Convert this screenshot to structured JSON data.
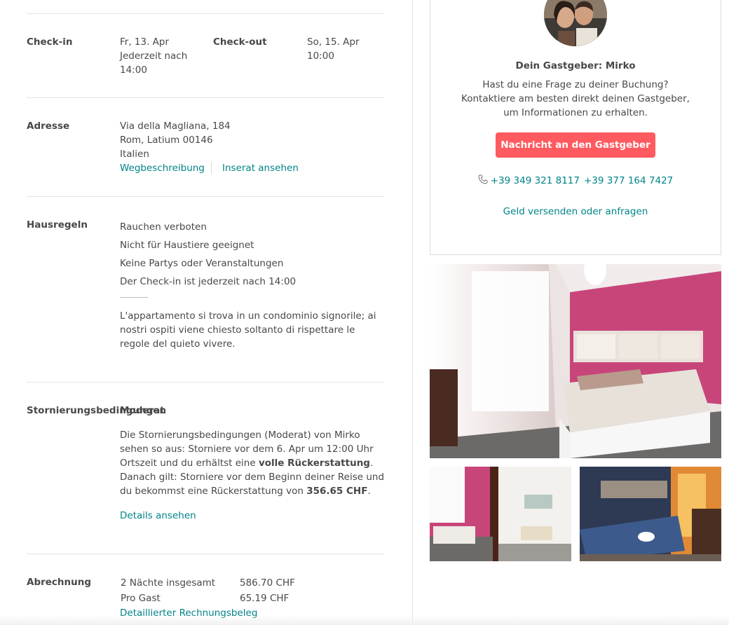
{
  "checkin": {
    "label": "Check-in",
    "date": "Fr, 13. Apr",
    "time": "Jederzeit nach 14:00",
    "checkout_label": "Check-out",
    "checkout_date": "So, 15. Apr",
    "checkout_time": "10:00"
  },
  "address": {
    "label": "Adresse",
    "line1": "Via della Magliana, 184",
    "line2": "Rom, Latium 00146",
    "line3": "Italien",
    "directions_link": "Wegbeschreibung",
    "listing_link": "Inserat ansehen"
  },
  "house_rules": {
    "label": "Hausregeln",
    "rules": [
      "Rauchen verboten",
      "Nicht für Haustiere geeignet",
      "Keine Partys oder Veranstaltungen",
      "Der Check-in ist jederzeit nach 14:00"
    ],
    "note": "L'appartamento si trova in un condominio signorile; ai nostri ospiti viene chiesto soltanto di rispettare le regole del quieto vivere."
  },
  "cancellation": {
    "label": "Stornierungsbedingungen",
    "policy": "Moderat",
    "text_1": "Die Stornierungsbedingungen (Moderat) von Mirko sehen so aus: Storniere vor dem 6. Apr um 12:00 Uhr Ortszeit und du erhältst eine ",
    "bold_1": "volle Rückerstattung",
    "text_2": ". Danach gilt: Storniere vor dem Beginn deiner Reise und du bekommst eine Rückerstattung von ",
    "bold_2": "356.65 CHF",
    "text_3": ".",
    "details_link": "Details ansehen"
  },
  "billing": {
    "label": "Abrechnung",
    "rows": [
      {
        "name": "2 Nächte insgesamt",
        "amount": "586.70 CHF"
      },
      {
        "name": "Pro Gast",
        "amount": "65.19 CHF"
      }
    ],
    "receipt_link": "Detaillierter Rechnungsbeleg"
  },
  "host": {
    "title": "Dein Gastgeber: Mirko",
    "desc": "Hast du eine Frage zu deiner Buchung? Kontaktiere am besten direkt deinen Gastgeber, um Informationen zu erhalten.",
    "message_button": "Nachricht an den Gastgeber",
    "phone_icon": "phone-icon",
    "phone_1": "+39 349 321 8117",
    "phone_2": "+39 377 164 7427",
    "money_link": "Geld versenden oder anfragen"
  },
  "colors": {
    "accent": "#ff5a5f",
    "link": "#008489",
    "text": "#484848"
  }
}
